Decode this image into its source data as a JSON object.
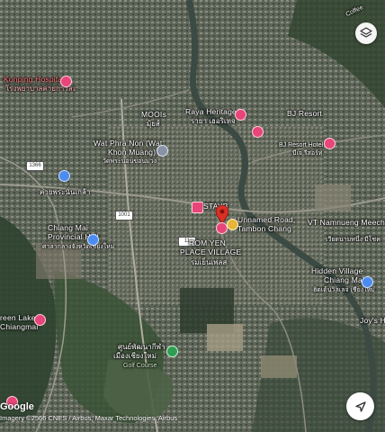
{
  "map": {
    "type": "satellite",
    "branding": "Google",
    "attribution": "Imagery ©2566 CNES / Airbus, Maxar Technologies, Airbus"
  },
  "places": {
    "konping": "Konping Hospital",
    "konping_th": "โรงพยาบาลค่ายกาวิละ",
    "moois": "MOOIs",
    "moois_th": "มุ้ยส์",
    "raya": "Raya Heritage",
    "raya_th": "รายา เฮอริเทจ",
    "bj_resort": "BJ Resort",
    "bj_resort_hotel": "BJ Resort Hotel",
    "bj_resort_th": "บีเจ รีสอร์ท",
    "wat_phra_non_1": "Wat Phra Non (Wat",
    "wat_phra_non_2": "Khon Muang)",
    "wat_phra_non_th": "วัดพระนอนขอนม่วง",
    "thai_label_1": "ค่ายพระนั่นเกล้า",
    "stayb": "STAYB",
    "unnamed_road_1": "Unnamed Road,",
    "unnamed_road_2": "Tambon Chang",
    "provincial_1": "Chiang Mai",
    "provincial_2": "Provincial Hall",
    "provincial_th": "ศาลากลางจังหวัดเชียงใหม่",
    "romyen_1": "ROM YEN",
    "romyen_2": "PLACE VILLAGE",
    "romyen_th": "รมเย็นเพลส",
    "vt_1": "VT Namnueng Meechok",
    "vt_th": "เวียดนามหนึ่ง มีโชค",
    "hidden_1": "Hidden Village",
    "hidden_2": "Chiang Mai",
    "hidden_th": "ฮิดเด้นวิลเลจ เชียงใหม่",
    "joys": "Joy's H",
    "greenlake_1": "reen Lake",
    "greenlake_2": "Chiangmai",
    "golf_th_1": "ศูนย์พัฒนากีฬา",
    "golf_th_2": "เมืองเชียงใหม่",
    "golf_en": "Golf Course",
    "top_right": "Coffee"
  },
  "roads": {
    "r1": "1366",
    "r2": "1001",
    "r3": "11"
  },
  "buttons": {
    "layers": "layers-icon",
    "nav": "navigation-arrow-icon"
  },
  "colors": {
    "pin_red": "#d93025",
    "pin_pink": "#e8457a",
    "river": "#3c4a44"
  }
}
